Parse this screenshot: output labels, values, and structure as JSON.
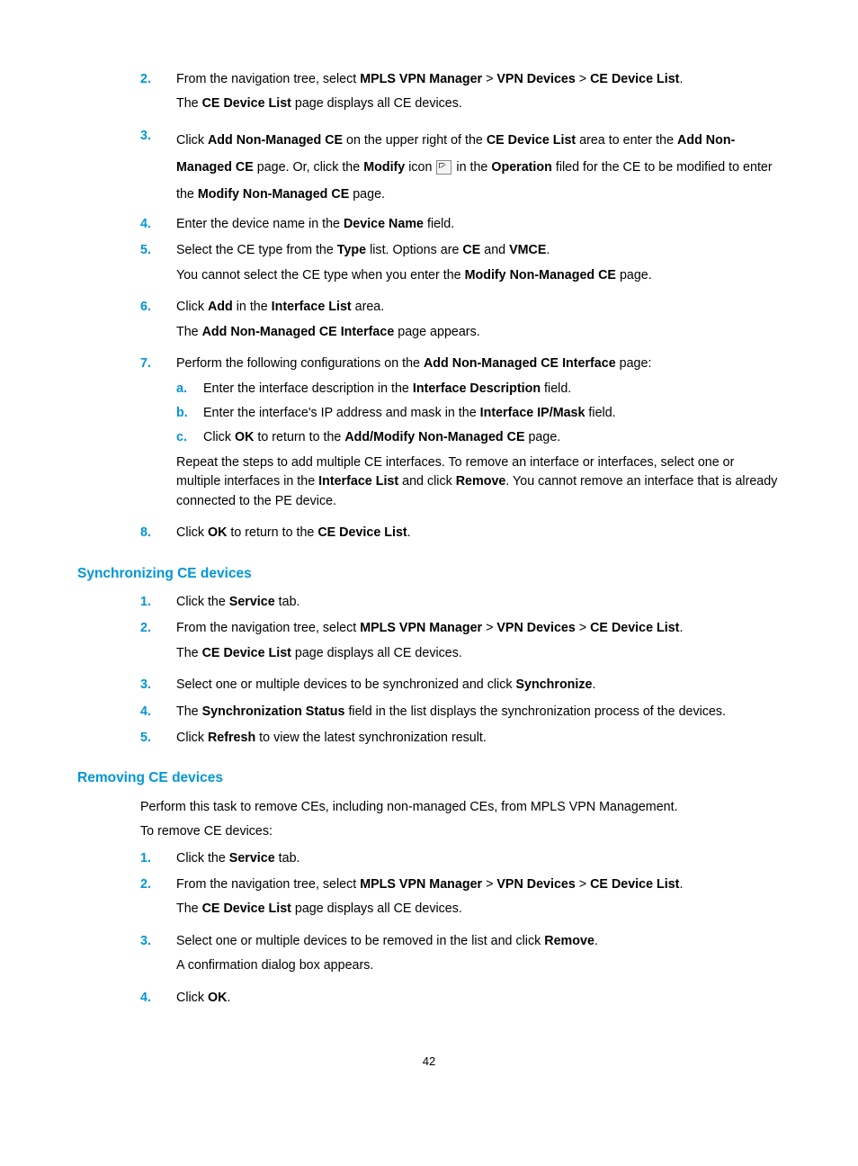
{
  "page_number": "42",
  "i2": {
    "n": "2.",
    "t1": "From the navigation tree, select ",
    "b1": "MPLS VPN Manager",
    "s1": " > ",
    "b2": "VPN Devices",
    "s2": " > ",
    "b3": "CE Device List",
    "s3": "."
  },
  "i2b": {
    "t1": "The ",
    "b1": "CE Device List",
    "t2": " page displays all CE devices."
  },
  "i3": {
    "n": "3.",
    "t1": "Click ",
    "b1": "Add Non-Managed CE",
    "t2": " on the upper right of the ",
    "b2": "CE Device List",
    "t3": " area to enter the ",
    "b3": "Add Non-Managed CE",
    "t4": " page. Or, click the ",
    "b4": "Modify",
    "t5": " icon ",
    "t6": " in the ",
    "b5": "Operation",
    "t7": " filed for the CE to be modified to enter the ",
    "b6": "Modify Non-Managed CE",
    "t8": " page."
  },
  "i4": {
    "n": "4.",
    "t1": "Enter the device name in the ",
    "b1": "Device Name",
    "t2": " field."
  },
  "i5": {
    "n": "5.",
    "t1": "Select the CE type from the ",
    "b1": "Type",
    "t2": " list. Options are ",
    "b2": "CE",
    "t3": " and ",
    "b3": "VMCE",
    "t4": "."
  },
  "i5b": {
    "t1": "You cannot select the CE type when you enter the ",
    "b1": "Modify Non-Managed CE",
    "t2": " page."
  },
  "i6": {
    "n": "6.",
    "t1": "Click ",
    "b1": "Add",
    "t2": " in the ",
    "b2": "Interface List",
    "t3": " area."
  },
  "i6b": {
    "t1": "The ",
    "b1": "Add Non-Managed CE Interface",
    "t2": " page appears."
  },
  "i7": {
    "n": "7.",
    "t1": "Perform the following configurations on the ",
    "b1": "Add Non-Managed CE Interface",
    "t2": " page:"
  },
  "i7a": {
    "n": "a.",
    "t1": "Enter the interface description in the ",
    "b1": "Interface Description",
    "t2": " field."
  },
  "i7b": {
    "n": "b.",
    "t1": "Enter the interface's IP address and mask in the ",
    "b1": "Interface IP/Mask",
    "t2": " field."
  },
  "i7c": {
    "n": "c.",
    "t1": "Click ",
    "b1": "OK",
    "t2": " to return to the ",
    "b2": "Add/Modify Non-Managed CE",
    "t3": " page."
  },
  "i7d": {
    "t1": "Repeat the steps to add multiple CE interfaces. To remove an interface or interfaces, select one or multiple interfaces in the ",
    "b1": "Interface List",
    "t2": " and click ",
    "b2": "Remove",
    "t3": ". You cannot remove an interface that is already connected to the PE device."
  },
  "i8": {
    "n": "8.",
    "t1": "Click ",
    "b1": "OK",
    "t2": " to return to the ",
    "b2": "CE Device List",
    "t3": "."
  },
  "h1": "Synchronizing CE devices",
  "s1": {
    "n": "1.",
    "t1": "Click the ",
    "b1": "Service",
    "t2": " tab."
  },
  "s2": {
    "n": "2.",
    "t1": "From the navigation tree, select ",
    "b1": "MPLS VPN Manager",
    "s1": " > ",
    "b2": "VPN Devices",
    "s2": " > ",
    "b3": "CE Device List",
    "s3": "."
  },
  "s2b": {
    "t1": "The ",
    "b1": "CE Device List",
    "t2": " page displays all CE devices."
  },
  "s3": {
    "n": "3.",
    "t1": "Select one or multiple devices to be synchronized and click ",
    "b1": "Synchronize",
    "t2": "."
  },
  "s4": {
    "n": "4.",
    "t1": "The ",
    "b1": "Synchronization Status",
    "t2": " field in the list displays the synchronization process of the devices."
  },
  "s5": {
    "n": "5.",
    "t1": "Click ",
    "b1": "Refresh",
    "t2": " to view the latest synchronization result."
  },
  "h2": "Removing CE devices",
  "r_p1": "Perform this task to remove CEs, including non-managed CEs, from MPLS VPN Management.",
  "r_p2": "To remove CE devices:",
  "r1": {
    "n": "1.",
    "t1": "Click the ",
    "b1": "Service",
    "t2": " tab."
  },
  "r2": {
    "n": "2.",
    "t1": "From the navigation tree, select ",
    "b1": "MPLS VPN Manager",
    "s1": " > ",
    "b2": "VPN Devices",
    "s2": " > ",
    "b3": "CE Device List",
    "s3": "."
  },
  "r2b": {
    "t1": "The ",
    "b1": "CE Device List",
    "t2": " page displays all CE devices."
  },
  "r3": {
    "n": "3.",
    "t1": "Select one or multiple devices to be removed in the list and click ",
    "b1": "Remove",
    "t2": "."
  },
  "r3b": {
    "t1": "A confirmation dialog box appears."
  },
  "r4": {
    "n": "4.",
    "t1": "Click ",
    "b1": "OK",
    "t2": "."
  }
}
